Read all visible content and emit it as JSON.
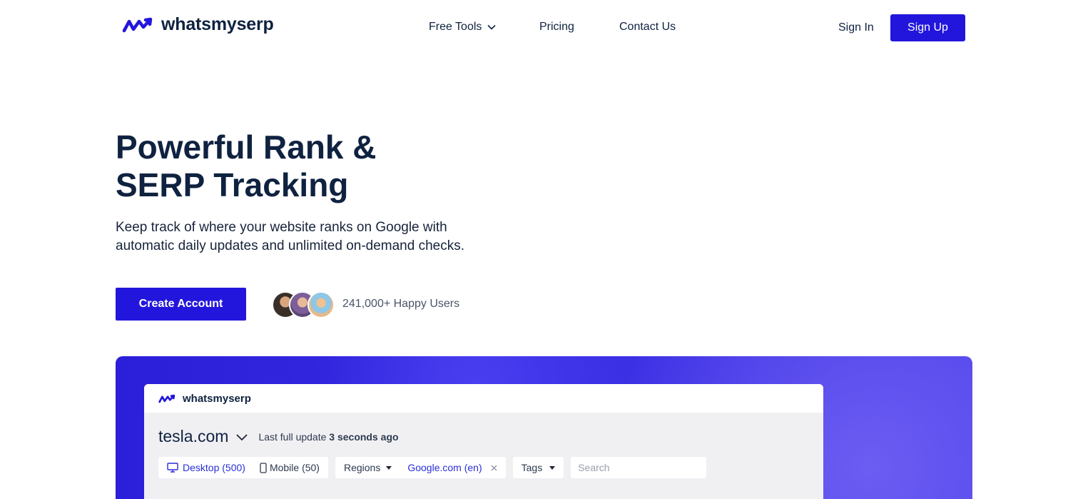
{
  "header": {
    "logo_text": "whatsmyserp",
    "nav": [
      {
        "label": "Free Tools"
      },
      {
        "label": "Pricing"
      },
      {
        "label": "Contact Us"
      }
    ],
    "sign_in": "Sign In",
    "sign_up": "Sign Up"
  },
  "hero": {
    "title_line1": "Powerful Rank &",
    "title_line2": "SERP Tracking",
    "subtitle": "Keep track of where your website ranks on Google with automatic daily updates and unlimited on-demand checks.",
    "cta": "Create Account",
    "users": "241,000+ Happy Users"
  },
  "preview": {
    "logo_text": "whatsmyserp",
    "domain": "tesla.com",
    "last_update_prefix": "Last full update",
    "last_update_value": "3 seconds ago",
    "filters": {
      "desktop": "Desktop (500)",
      "mobile": "Mobile (50)",
      "regions": "Regions",
      "region_value": "Google.com (en)",
      "tags": "Tags",
      "search_placeholder": "Search"
    }
  },
  "colors": {
    "brand": "#2316dc",
    "heading": "#0f2240"
  }
}
